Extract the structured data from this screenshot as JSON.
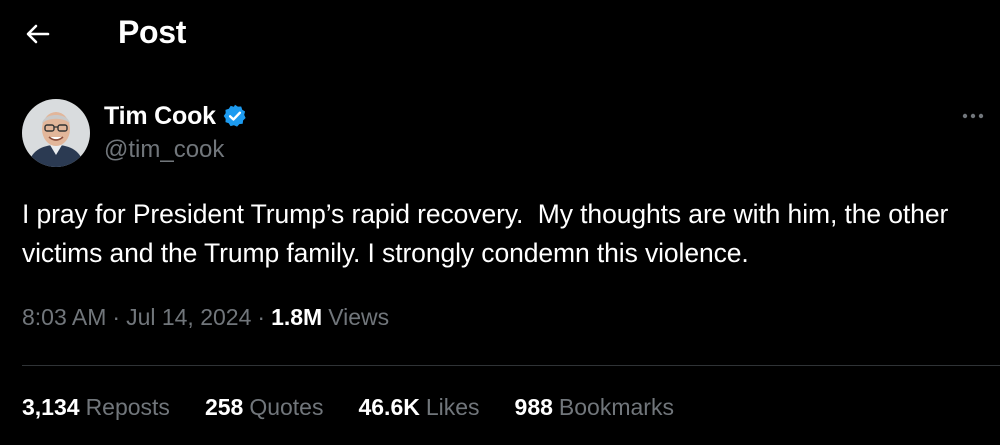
{
  "header": {
    "title": "Post",
    "back_icon": "arrow-left-icon"
  },
  "post": {
    "author": {
      "name": "Tim Cook",
      "handle": "@tim_cook",
      "verified": true,
      "verified_color": "#1d9bf0",
      "avatar_icon": "user-avatar"
    },
    "more_icon": "more-horizontal-icon",
    "text": "I pray for President Trump’s rapid recovery.  My thoughts are with him, the other victims and the Trump family. I strongly condemn this violence.",
    "time": "8:03 AM",
    "date": "Jul 14, 2024",
    "views_count": "1.8M",
    "views_label": "Views",
    "stats": [
      {
        "count": "3,134",
        "label": "Reposts"
      },
      {
        "count": "258",
        "label": "Quotes"
      },
      {
        "count": "46.6K",
        "label": "Likes"
      },
      {
        "count": "988",
        "label": "Bookmarks"
      }
    ]
  },
  "colors": {
    "background": "#000000",
    "text_primary": "#e7e9ea",
    "text_secondary": "#71767b",
    "divider": "#2f3336",
    "accent": "#1d9bf0"
  }
}
